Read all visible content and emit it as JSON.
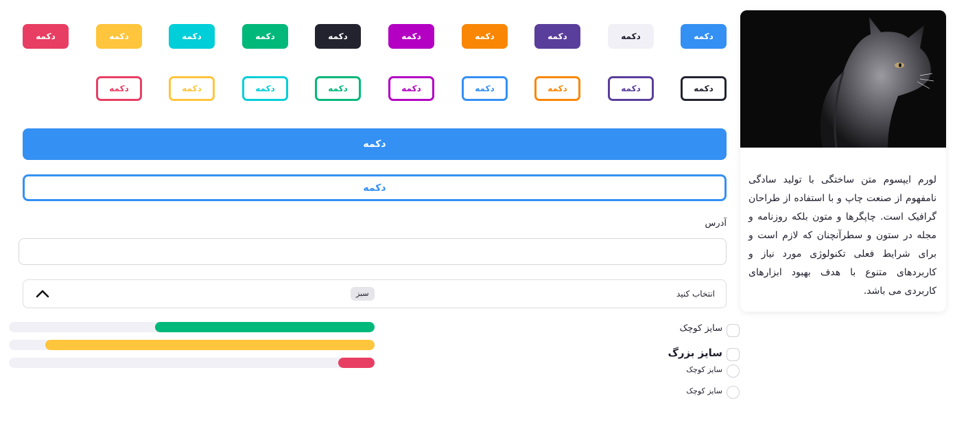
{
  "buttons": {
    "solid": [
      {
        "label": "دکمه",
        "color": "#3490f3",
        "text_color": "#ffffff",
        "name": "solid-button-blue"
      },
      {
        "label": "دکمه",
        "color": "#f1f0f6",
        "text_color": "#1f1f2e",
        "name": "solid-button-light"
      },
      {
        "label": "دکمه",
        "color": "#5a3e9b",
        "text_color": "#ffffff",
        "name": "solid-button-purple"
      },
      {
        "label": "دکمه",
        "color": "#f98705",
        "text_color": "#ffffff",
        "name": "solid-button-orange"
      },
      {
        "label": "دکمه",
        "color": "#b300c3",
        "text_color": "#ffffff",
        "name": "solid-button-magenta"
      },
      {
        "label": "دکمه",
        "color": "#232330",
        "text_color": "#ffffff",
        "name": "solid-button-dark"
      },
      {
        "label": "دکمه",
        "color": "#00b87a",
        "text_color": "#ffffff",
        "name": "solid-button-green"
      },
      {
        "label": "دکمه",
        "color": "#00ced8",
        "text_color": "#ffffff",
        "name": "solid-button-cyan"
      },
      {
        "label": "دکمه",
        "color": "#ffc53c",
        "text_color": "#ffffff",
        "name": "solid-button-yellow"
      },
      {
        "label": "دکمه",
        "color": "#e83e63",
        "text_color": "#ffffff",
        "name": "solid-button-red"
      }
    ],
    "outline": [
      {
        "label": "دکمه",
        "color": "#232330",
        "name": "outline-button-dark"
      },
      {
        "label": "دکمه",
        "color": "#5a3e9b",
        "name": "outline-button-purple"
      },
      {
        "label": "دکمه",
        "color": "#f98705",
        "name": "outline-button-orange"
      },
      {
        "label": "دکمه",
        "color": "#3490f3",
        "name": "outline-button-blue"
      },
      {
        "label": "دکمه",
        "color": "#b300c3",
        "name": "outline-button-magenta"
      },
      {
        "label": "دکمه",
        "color": "#00b87a",
        "name": "outline-button-green"
      },
      {
        "label": "دکمه",
        "color": "#00ced8",
        "name": "outline-button-cyan"
      },
      {
        "label": "دکمه",
        "color": "#ffc53c",
        "name": "outline-button-yellow"
      },
      {
        "label": "دکمه",
        "color": "#e83e63",
        "name": "outline-button-red"
      }
    ],
    "block_solid": {
      "label": "دکمه",
      "color": "#3490f3"
    },
    "block_outline": {
      "label": "دکمه",
      "color": "#3490f3"
    }
  },
  "address": {
    "label": "آدرس",
    "value": ""
  },
  "select": {
    "placeholder": "انتخاب کنید",
    "selected_tag": "سبز",
    "icon": "chevron-up-icon"
  },
  "progress": [
    {
      "value": 0.6,
      "color": "#00b87a"
    },
    {
      "value": 0.9,
      "color": "#ffc53c"
    },
    {
      "value": 0.1,
      "color": "#e83e63"
    }
  ],
  "options": {
    "checkbox_small": "سایز کوچک",
    "checkbox_large": "سایز بزرگ",
    "radio_1": "سایز کوچک",
    "radio_2": "سایز کوچک"
  },
  "card": {
    "image": "cat-photo",
    "text": "لورم ایپسوم متن ساختگی با تولید سادگی نامفهوم از صنعت چاپ و با استفاده از طراحان گرافیک است. چاپگرها و متون بلکه روزنامه و مجله در ستون و سطرآنچنان که لازم است و برای شرایط فعلی تکنولوژی مورد نیاز و کاربردهای متنوع با هدف بهبود ابزارهای کاربردی می باشد."
  }
}
